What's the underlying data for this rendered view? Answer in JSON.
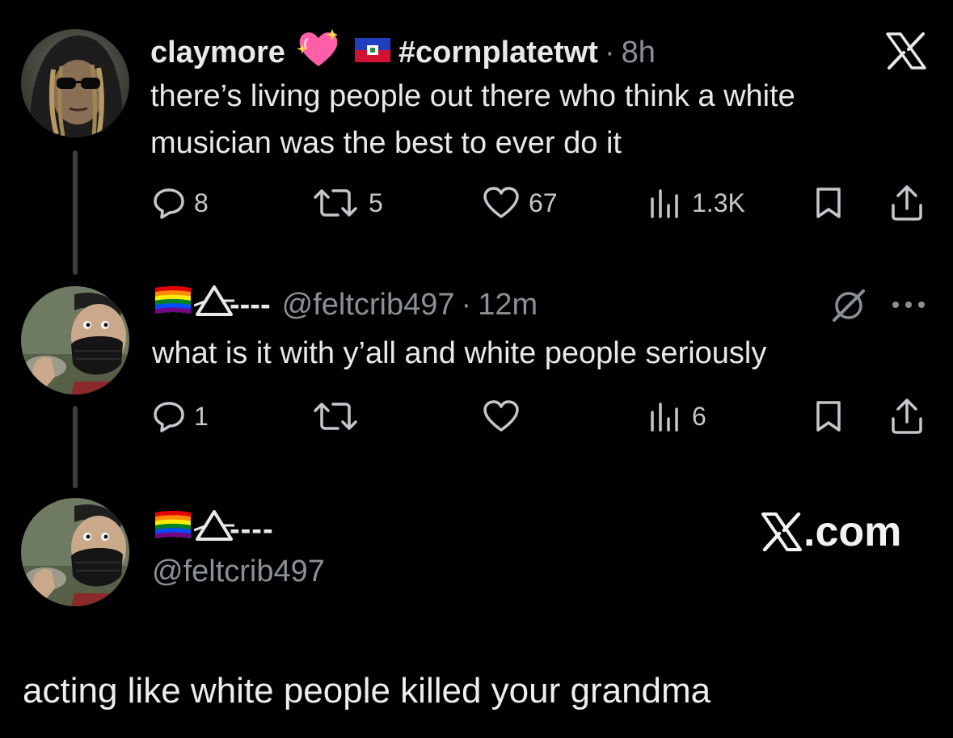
{
  "tweet1": {
    "name": "claymore",
    "hashtag": "#cornplatetwt",
    "time": "8h",
    "text_line1": "there’s living people out there who think a white",
    "text_line2": "musician was the best to ever do it",
    "replies": "8",
    "reposts": "5",
    "likes": "67",
    "views": "1.3K"
  },
  "tweet2": {
    "name_dashes": "----",
    "handle": "@feltcrib497",
    "time": "12m",
    "text": "what is it with y’all and white people seriously",
    "replies": "1",
    "reposts": "",
    "likes": "",
    "views": "6"
  },
  "profile": {
    "name_dashes": "----",
    "handle": "@feltcrib497",
    "site": ".com"
  },
  "caption": "acting like white people killed your grandma",
  "icons": {
    "heart_emoji": "sparkling-heart-icon",
    "haiti_flag": "haiti-flag-icon",
    "pride_flag": "rainbow-flag-icon",
    "prism": "prism-triangle-icon",
    "x_logo": "x-logo-icon",
    "grok": "grok-icon",
    "more": "more-icon",
    "reply": "reply-icon",
    "repost": "repost-icon",
    "like": "like-icon",
    "views": "views-icon",
    "bookmark": "bookmark-icon",
    "share": "share-icon"
  },
  "colors": {
    "background": "#000000",
    "text": "#e7e9ea",
    "muted": "#8b9096",
    "thread_line": "#3a3d41",
    "heart_pink": "#ff5fa8"
  }
}
